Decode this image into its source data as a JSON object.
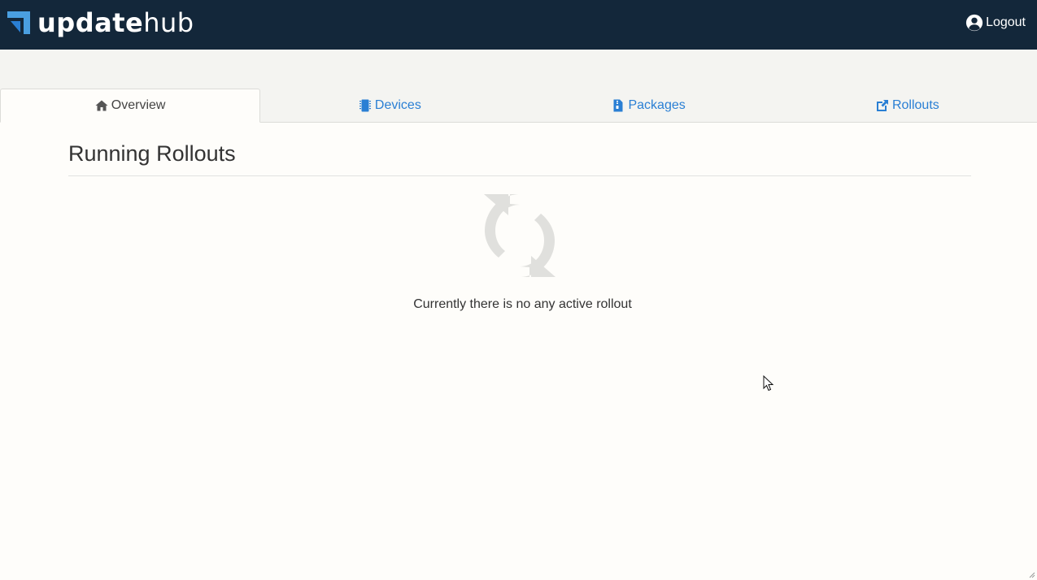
{
  "navbar": {
    "brand_bold": "update",
    "brand_light": "hub",
    "logout_label": "Logout",
    "icons": {
      "brand": "updatehub-logo-icon",
      "logout": "user-circle-icon"
    }
  },
  "tabs": [
    {
      "label": "Overview",
      "icon": "home-icon",
      "active": true
    },
    {
      "label": "Devices",
      "icon": "microchip-icon",
      "active": false
    },
    {
      "label": "Packages",
      "icon": "file-archive-icon",
      "active": false
    },
    {
      "label": "Rollouts",
      "icon": "external-link-icon",
      "active": false
    }
  ],
  "main": {
    "title": "Running Rollouts",
    "empty_icon": "refresh-icon",
    "empty_message": "Currently there is no any active rollout"
  },
  "colors": {
    "navbar_bg": "#13273a",
    "link": "#2a7fd4",
    "page_bg": "#fefdfa",
    "subbar_bg": "#f4f4f1",
    "empty_icon": "#e0e0dd"
  }
}
